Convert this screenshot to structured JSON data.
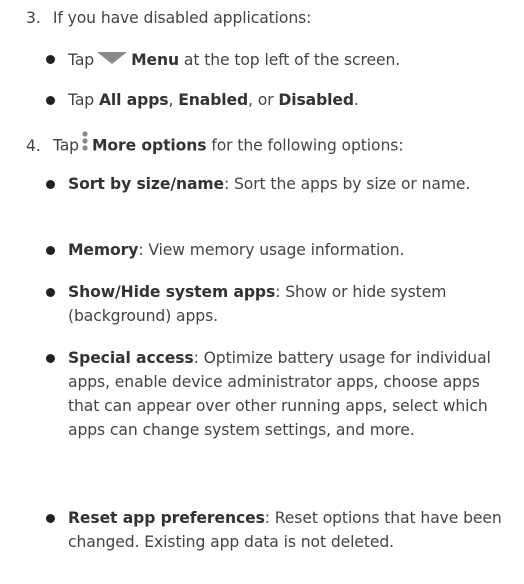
{
  "steps": [
    {
      "number": "3.",
      "text": "If you have disabled applications:",
      "bullets": [
        {
          "pre": "Tap",
          "icon": "menu-triangle-icon",
          "bold": "Menu",
          "rest": " at the top left of the screen."
        },
        {
          "pre": "Tap ",
          "bold_a": "All apps",
          "sep_a": ", ",
          "bold_b": "Enabled",
          "sep_b": ", or ",
          "bold_c": "Disabled",
          "end": "."
        }
      ]
    },
    {
      "number": "4.",
      "pre": "Tap",
      "icon": "more-options-icon",
      "bold": "More options",
      "rest": " for the following options:",
      "bullets": [
        {
          "bold": "Sort by size/name",
          "rest": ": Sort the apps by size or name."
        },
        {
          "bold": "Memory",
          "rest": ": View memory usage information."
        },
        {
          "bold": "Show/Hide system apps",
          "rest": ": Show or hide system (background) apps."
        },
        {
          "bold": "Special access",
          "rest": ": Optimize battery usage for individual apps, enable device administrator apps, choose apps that can appear over other running apps, select which apps can change system settings, and more."
        },
        {
          "bold": "Reset app preferences",
          "rest": ": Reset options that have been changed. Existing app data is not deleted."
        }
      ]
    }
  ],
  "colors": {
    "text": "#444444",
    "bold": "#333333",
    "icon": "#8a8a8a"
  }
}
